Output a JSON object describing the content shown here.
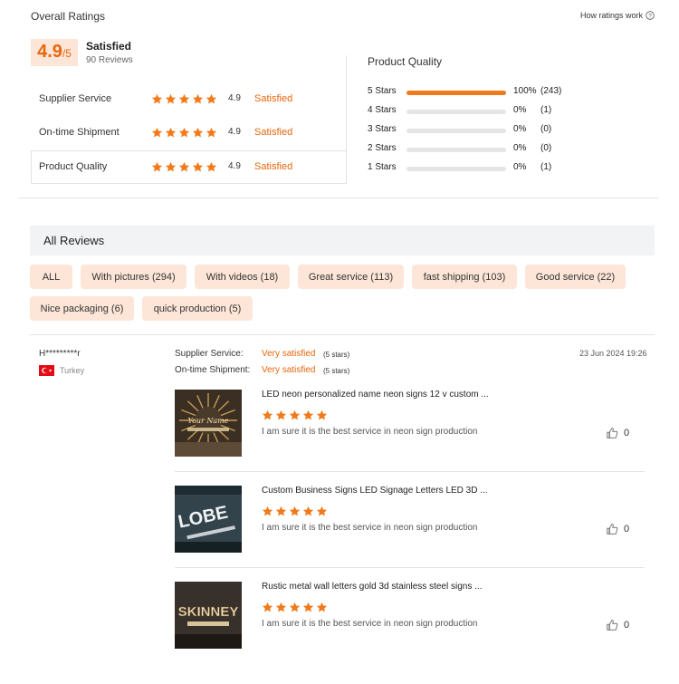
{
  "overall": {
    "title": "Overall Ratings",
    "how_link": "How ratings work",
    "score": "4.9",
    "score_suffix": "/5",
    "label": "Satisfied",
    "reviews_count": "90 Reviews"
  },
  "sub_ratings": [
    {
      "name": "Supplier Service",
      "score": "4.9",
      "label": "Satisfied",
      "stars": 5
    },
    {
      "name": "On-time Shipment",
      "score": "4.9",
      "label": "Satisfied",
      "stars": 5
    },
    {
      "name": "Product Quality",
      "score": "4.9",
      "label": "Satisfied",
      "stars": 5
    }
  ],
  "quality": {
    "title": "Product Quality",
    "rows": [
      {
        "label": "5 Stars",
        "percent_label": "100%",
        "count": "(243)",
        "fill": 1.0
      },
      {
        "label": "4 Stars",
        "percent_label": "0%",
        "count": "(1)",
        "fill": 0.0
      },
      {
        "label": "3 Stars",
        "percent_label": "0%",
        "count": "(0)",
        "fill": 0.0
      },
      {
        "label": "2 Stars",
        "percent_label": "0%",
        "count": "(0)",
        "fill": 0.0
      },
      {
        "label": "1 Stars",
        "percent_label": "0%",
        "count": "(1)",
        "fill": 0.0
      }
    ]
  },
  "all_reviews": {
    "title": "All Reviews",
    "filters": [
      "ALL",
      "With pictures (294)",
      "With videos (18)",
      "Great service (113)",
      "fast shipping (103)",
      "Good service (22)",
      "Nice packaging (6)",
      "quick production (5)"
    ]
  },
  "review": {
    "user": "H*********r",
    "country": "Turkey",
    "date": "23 Jun 2024 19:26",
    "supplier_label": "Supplier Service:",
    "supplier_value": "Very satisfied",
    "supplier_stars": "(5 stars)",
    "shipment_label": "On-time Shipment:",
    "shipment_value": "Very satisfied",
    "shipment_stars": "(5 stars)",
    "items": [
      {
        "title": "LED neon personalized name neon signs 12 v custom ...",
        "comment": "I am sure it is the best service in neon sign production",
        "likes": "0",
        "stars": 5,
        "thumb_text": "Your Name"
      },
      {
        "title": "Custom Business Signs LED Signage Letters LED 3D ...",
        "comment": "I am sure it is the best service in neon sign production",
        "likes": "0",
        "stars": 5,
        "thumb_text": "LOBE"
      },
      {
        "title": "Rustic metal wall letters gold 3d stainless steel signs ...",
        "comment": "I am sure it is the best service in neon sign production",
        "likes": "0",
        "stars": 5,
        "thumb_text": "SKINNEY"
      }
    ]
  },
  "colors": {
    "accent": "#e8650a",
    "bar": "#f27a1a",
    "chip_bg": "#fde6d8",
    "score_bg": "#fde6d8"
  }
}
